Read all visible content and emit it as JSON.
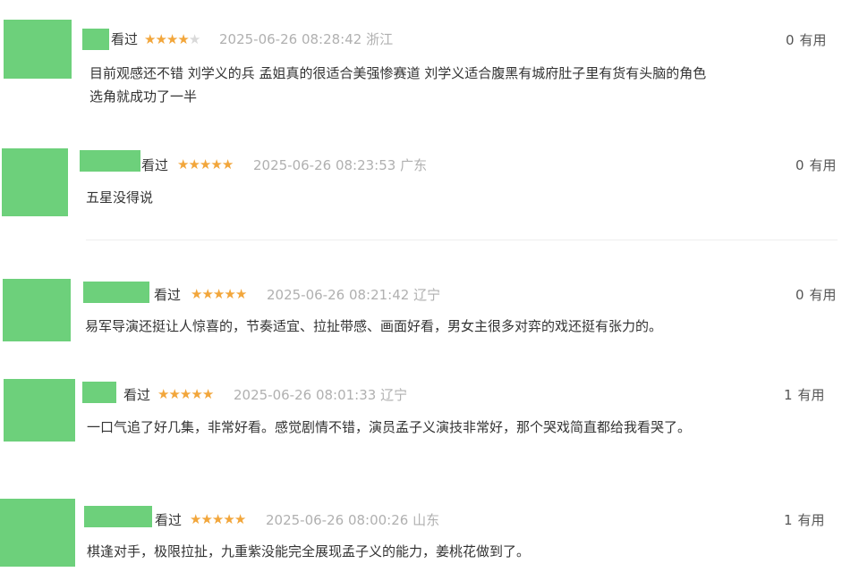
{
  "comments": [
    {
      "status": "看过",
      "rating": 4,
      "time": "2025-06-26 08:28:42",
      "location": "浙江",
      "useful_count": "0",
      "useful_label": "有用",
      "lines": [
        "目前观感还不错 刘学义的兵 孟姐真的很适合美强惨赛道 刘学义适合腹黑有城府肚子里有货有头脑的角色",
        "选角就成功了一半"
      ]
    },
    {
      "status": "看过",
      "rating": 5,
      "time": "2025-06-26 08:23:53",
      "location": "广东",
      "useful_count": "0",
      "useful_label": "有用",
      "lines": [
        "五星没得说"
      ]
    },
    {
      "status": "看过",
      "rating": 5,
      "time": "2025-06-26 08:21:42",
      "location": "辽宁",
      "useful_count": "0",
      "useful_label": "有用",
      "lines": [
        "易军导演还挺让人惊喜的，节奏适宜、拉扯带感、画面好看，男女主很多对弈的戏还挺有张力的。"
      ]
    },
    {
      "status": "看过",
      "rating": 5,
      "time": "2025-06-26 08:01:33",
      "location": "辽宁",
      "useful_count": "1",
      "useful_label": "有用",
      "lines": [
        "一口气追了好几集，非常好看。感觉剧情不错，演员孟子义演技非常好，那个哭戏简直都给我看哭了。"
      ]
    },
    {
      "status": "看过",
      "rating": 5,
      "time": "2025-06-26 08:00:26",
      "location": "山东",
      "useful_count": "1",
      "useful_label": "有用",
      "lines": [
        "棋逢对手，极限拉扯，九重紫没能完全展现孟子义的能力，姜桃花做到了。"
      ]
    }
  ],
  "colors": {
    "avatar": "#6dd07b",
    "star_on": "#f2a63b",
    "star_off": "#d9d9d9",
    "time": "#b0b0b0"
  },
  "icons": {
    "star": "star-icon"
  }
}
